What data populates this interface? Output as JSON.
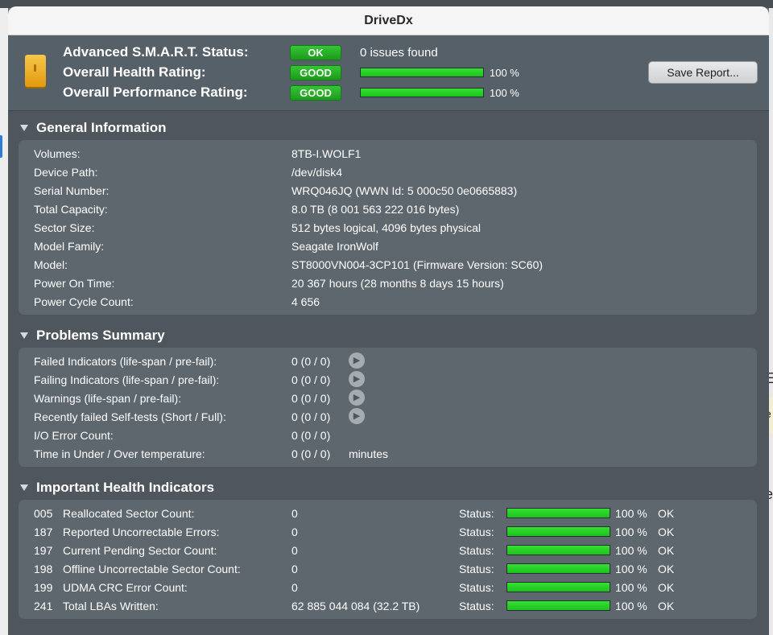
{
  "window": {
    "title": "DriveDx"
  },
  "header": {
    "smart_label": "Advanced S.M.A.R.T. Status:",
    "smart_badge": "OK",
    "smart_text": "0 issues found",
    "health_label": "Overall Health Rating:",
    "health_badge": "GOOD",
    "health_pct": "100 %",
    "health_value": 100,
    "perf_label": "Overall Performance Rating:",
    "perf_badge": "GOOD",
    "perf_pct": "100 %",
    "perf_value": 100,
    "save_button": "Save Report..."
  },
  "general": {
    "title": "General Information",
    "rows": [
      {
        "label": "Volumes:",
        "value": "8TB-I.WOLF1"
      },
      {
        "label": "Device Path:",
        "value": "/dev/disk4"
      },
      {
        "label": "Serial Number:",
        "value": "WRQ046JQ (WWN Id: 5 000c50 0e0665883)"
      },
      {
        "label": "Total Capacity:",
        "value": "8.0 TB (8 001 563 222 016 bytes)"
      },
      {
        "label": "Sector Size:",
        "value": "512 bytes logical, 4096 bytes physical"
      },
      {
        "label": "Model Family:",
        "value": "Seagate IronWolf"
      },
      {
        "label": "Model:",
        "value": "ST8000VN004-3CP101  (Firmware Version: SC60)"
      },
      {
        "label": "Power On Time:",
        "value": "20 367 hours (28 months 8 days 15 hours)"
      },
      {
        "label": "Power Cycle Count:",
        "value": "4 656"
      }
    ]
  },
  "problems": {
    "title": "Problems Summary",
    "rows": [
      {
        "label": "Failed Indicators (life-span / pre-fail):",
        "value": "0 (0 / 0)"
      },
      {
        "label": "Failing Indicators (life-span / pre-fail):",
        "value": "0 (0 / 0)"
      },
      {
        "label": "Warnings (life-span / pre-fail):",
        "value": "0 (0 / 0)"
      },
      {
        "label": "Recently failed Self-tests (Short / Full):",
        "value": "0 (0 / 0)"
      },
      {
        "label": "I/O Error Count:",
        "value": "0 (0 / 0)"
      },
      {
        "label": "Time in Under / Over temperature:",
        "value": "0 (0 / 0)",
        "unit": "minutes"
      }
    ]
  },
  "health": {
    "title": "Important Health Indicators",
    "status_label": "Status:",
    "rows": [
      {
        "code": "005",
        "label": "Reallocated Sector Count:",
        "value": "0",
        "pct": "100 %",
        "level": 100,
        "state": "OK"
      },
      {
        "code": "187",
        "label": "Reported Uncorrectable Errors:",
        "value": "0",
        "pct": "100 %",
        "level": 100,
        "state": "OK"
      },
      {
        "code": "197",
        "label": "Current Pending Sector Count:",
        "value": "0",
        "pct": "100 %",
        "level": 100,
        "state": "OK"
      },
      {
        "code": "198",
        "label": "Offline Uncorrectable Sector Count:",
        "value": "0",
        "pct": "100 %",
        "level": 100,
        "state": "OK"
      },
      {
        "code": "199",
        "label": "UDMA CRC Error Count:",
        "value": "0",
        "pct": "100 %",
        "level": 100,
        "state": "OK"
      },
      {
        "code": "241",
        "label": "Total LBAs Written:",
        "value": "62 885 044 084 (32.2 TB)",
        "pct": "100 %",
        "level": 100,
        "state": "OK"
      }
    ]
  },
  "desktop": {
    "peek_1": "E",
    "peek_2": "e",
    "peek_3": "e"
  }
}
